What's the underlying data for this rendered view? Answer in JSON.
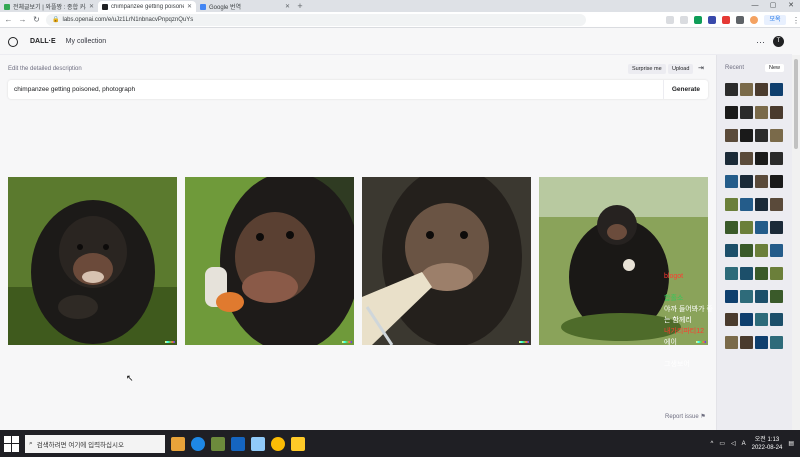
{
  "browser": {
    "tabs": [
      {
        "title": "전체글보기 | 와플짱 : 종합 커사이트",
        "favicon_color": "#34a853",
        "active": false
      },
      {
        "title": "chimpanzee getting poisoned...",
        "favicon_color": "#202123",
        "active": true
      },
      {
        "title": "Google 번역",
        "favicon_color": "#4285f4",
        "active": false
      }
    ],
    "new_tab": "+",
    "url": "labs.openai.com/e/uJz1LrN1nbnacvPnpqznQuYs",
    "profile_label": "모옥"
  },
  "app": {
    "brand": "DALL·E",
    "nav_link": "My collection",
    "avatar_letter": "T"
  },
  "editor": {
    "label": "Edit the detailed description",
    "surprise_label": "Surprise me",
    "upload_label": "Upload",
    "prompt_value": "chimpanzee getting poisoned, photograph",
    "generate_label": "Generate"
  },
  "overlay_lines": [
    {
      "text": "blogot",
      "color": "#ff3b30"
    },
    {
      "text": "",
      "color": "#ffffff"
    },
    {
      "text": "합홀소",
      "color": "#34c759"
    },
    {
      "text": "야까 들어봐가 좋는 함께리",
      "color": "#ffffff"
    },
    {
      "text": "내가리파티12",
      "color": "#ff3b30"
    },
    {
      "text": "에이",
      "color": "#ffffff"
    },
    {
      "text": "",
      "color": "#7b2cbf"
    },
    {
      "text": "그생보어",
      "color": "#ffffff"
    }
  ],
  "recent": {
    "label": "Recent",
    "new_label": "New"
  },
  "report_label": "Report issue ⚑",
  "taskbar": {
    "search_placeholder": "검색하려면 여기에 입력하십시오",
    "time": "오전 1:13",
    "date": "2022-08-24"
  }
}
